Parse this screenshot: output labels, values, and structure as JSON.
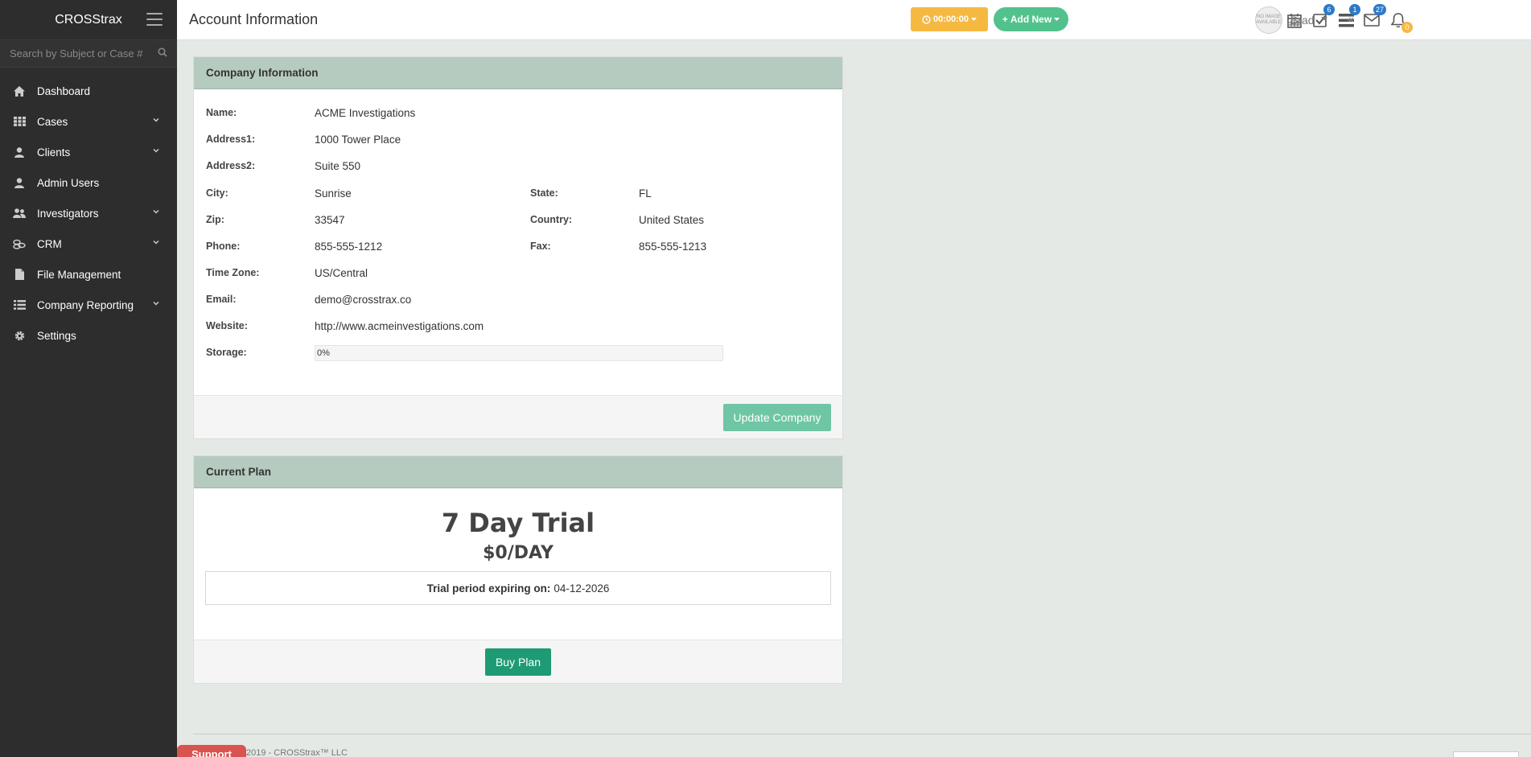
{
  "sidebar": {
    "brand": "CROSStrax",
    "search_placeholder": "Search by Subject or Case #",
    "items": [
      {
        "label": "Dashboard",
        "icon": "home-icon"
      },
      {
        "label": "Cases",
        "icon": "grid-icon"
      },
      {
        "label": "Clients",
        "icon": "user-icon"
      },
      {
        "label": "Admin Users",
        "icon": "user-icon"
      },
      {
        "label": "Investigators",
        "icon": "users-icon"
      },
      {
        "label": "CRM",
        "icon": "coins-icon"
      },
      {
        "label": "File Management",
        "icon": "file-icon"
      },
      {
        "label": "Company Reporting",
        "icon": "list-icon"
      },
      {
        "label": "Settings",
        "icon": "gear-icon"
      }
    ]
  },
  "header": {
    "title": "Account Information",
    "timer": "00:00:00",
    "add_new": "Add New",
    "badges": {
      "tasks": "6",
      "cases": "1",
      "mail": "27",
      "notifications": "0"
    },
    "user": "Brad",
    "avatar_text": "NO IMAGE AVAILABLE"
  },
  "company": {
    "heading": "Company Information",
    "labels": {
      "name": "Name:",
      "address1": "Address1:",
      "address2": "Address2:",
      "city": "City:",
      "state": "State:",
      "zip": "Zip:",
      "country": "Country:",
      "phone": "Phone:",
      "fax": "Fax:",
      "timezone": "Time Zone:",
      "email": "Email:",
      "website": "Website:",
      "storage": "Storage:"
    },
    "values": {
      "name": "ACME Investigations",
      "address1": "1000 Tower Place",
      "address2": "Suite 550",
      "city": "Sunrise",
      "state": "FL",
      "zip": "33547",
      "country": "United States",
      "phone": "855-555-1212",
      "fax": "855-555-1213",
      "timezone": "US/Central",
      "email": "demo@crosstrax.co",
      "website": "http://www.acmeinvestigations.com",
      "storage": "0%"
    },
    "storage_fraction": 0,
    "update_button": "Update Company"
  },
  "plan": {
    "heading": "Current Plan",
    "name": "7 Day Trial",
    "price": "$0/DAY",
    "trial_label": "Trial period expiring on:",
    "trial_date": "04-12-2026",
    "buy_button": "Buy Plan"
  },
  "footer": {
    "support": "Support",
    "copyright": "2019 - CROSStrax™ LLC"
  },
  "colors": {
    "sidebar_bg": "#2d2d2d",
    "panel_head": "#b6cbbf",
    "accent_green": "#1e9b74",
    "timer_yellow": "#f5b942",
    "support_red": "#d9534f"
  }
}
